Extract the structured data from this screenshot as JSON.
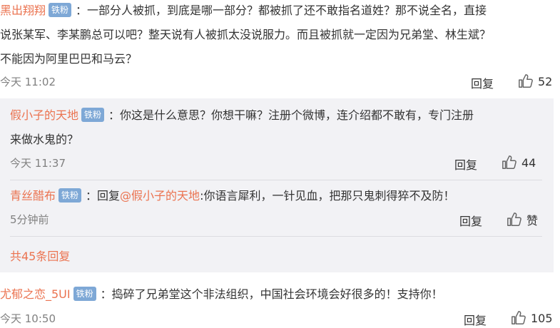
{
  "comment1": {
    "username": "黑出翔翔",
    "badge": "铁粉",
    "line1": "：一部分人被抓，到底是哪一部分？都被抓了还不敢指名道姓？那不说全名，直接",
    "line2": "说张某军、李某鹏总可以吧？整天说有人被抓太没说服力。而且被抓就一定因为兄弟堂、林生斌？",
    "line3": "不能因为阿里巴巴和马云？",
    "time": "今天 11:02",
    "reply_label": "回复",
    "likes": "52"
  },
  "reply1": {
    "username": "假小子的天地",
    "badge": "铁粉",
    "line1": "：你这是什么意思？你想干嘛？注册个微博，连介绍都不敢有，专门注册",
    "line2": "来做水鬼的？",
    "time": "今天 11:37",
    "reply_label": "回复",
    "likes": "44"
  },
  "reply2": {
    "username": "青丝醋布",
    "badge": "铁粉",
    "prefix": "：回复",
    "mention": "@假小子的天地",
    "text": ":你语言犀利，一针见血，把那只鬼刺得猝不及防！",
    "time": "5分钟前",
    "reply_label": "回复",
    "like_label": "赞"
  },
  "more_replies": "共45条回复",
  "comment2": {
    "username": "尤郁之恋_5UI",
    "badge": "铁粉",
    "text": "：捣碎了兄弟堂这个非法组织，中国社会环境会好很多的！支持你！",
    "time": "今天 10:50",
    "reply_label": "回复",
    "likes": "105"
  },
  "colors": {
    "username": "#eb7350",
    "badge_bg": "#7ea8d6",
    "panel_bg": "#f2f2f5",
    "meta": "#808080"
  }
}
